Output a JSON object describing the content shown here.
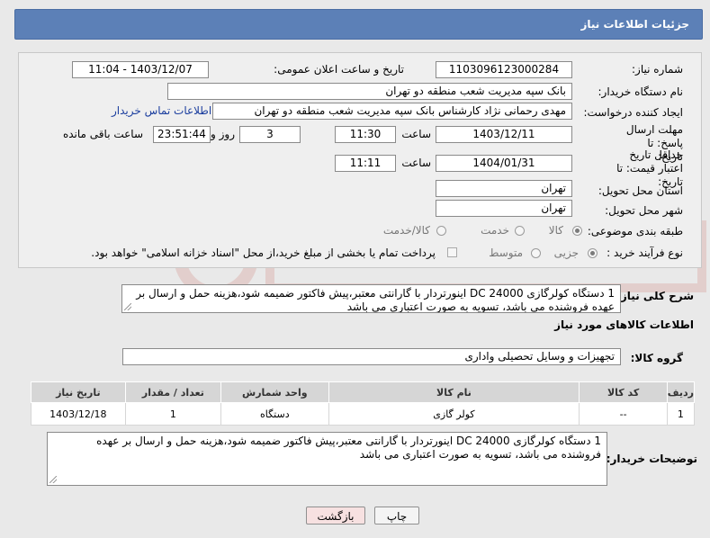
{
  "header": {
    "title": "جزئیات اطلاعات نیاز"
  },
  "form": {
    "need_number_label": "شماره نیاز:",
    "need_number": "1103096123000284",
    "announce_label": "تاریخ و ساعت اعلان عمومی:",
    "announce_value": "1403/12/07 - 11:04",
    "buyer_label": "نام دستگاه خریدار:",
    "buyer_value": "بانک سپه مدیریت شعب منطقه دو تهران",
    "creator_label": "ایجاد کننده درخواست:",
    "creator_value": "مهدی رحمانی نژاد کارشناس بانک سپه مدیریت شعب منطقه دو تهران",
    "contact_link": "اطلاعات تماس خریدار",
    "deadline_label": "مهلت ارسال پاسخ: تا تاریخ:",
    "deadline_date": "1403/12/11",
    "time_label": "ساعت",
    "deadline_time": "11:30",
    "days_value": "3",
    "days_label": "روز و",
    "remaining_time": "23:51:44",
    "remaining_label": "ساعت باقی مانده",
    "price_label": "حداقل تاریخ اعتبار قیمت: تا تاریخ:",
    "price_date": "1404/01/31",
    "price_time": "11:11",
    "province_label": "استان محل تحویل:",
    "province_value": "تهران",
    "city_label": "شهر محل تحویل:",
    "city_value": "تهران",
    "category_label": "طبقه بندی موضوعی:",
    "category_options": [
      "کالا",
      "خدمت",
      "کالا/خدمت"
    ],
    "process_label": "نوع فرآیند خرید :",
    "process_options": [
      "جزیی",
      "متوسط"
    ],
    "payment_text": "پرداخت تمام یا بخشی از مبلغ خرید،از محل \"اسناد خزانه اسلامی\" خواهد بود."
  },
  "summary": {
    "label": "شرح کلی نیاز:",
    "text": "1 دستگاه کولرگازی DC 24000 اینورتردار با گارانتی معتبر،پیش فاکتور  ضمیمه شود،هزینه حمل و ارسال بر عهده فروشنده می باشد، تسویه به صورت اعتباری می باشد"
  },
  "goods_info": {
    "title": "اطلاعات کالاهای مورد نیاز",
    "group_label": "گروه کالا:",
    "group_value": "تجهیزات و وسایل تحصیلی واداری"
  },
  "table": {
    "headers": [
      "ردیف",
      "کد کالا",
      "نام کالا",
      "واحد شمارش",
      "تعداد / مقدار",
      "تاریخ نیاز"
    ],
    "rows": [
      [
        "1",
        "--",
        "کولر گازی",
        "دستگاه",
        "1",
        "1403/12/18"
      ]
    ]
  },
  "buyer_notes": {
    "label": "توضیحات خریدار:",
    "text": "1 دستگاه کولرگازی DC 24000 اینورتردار با گارانتی معتبر،پیش فاکتور  ضمیمه شود،هزینه حمل و ارسال بر عهده فروشنده می باشد، تسویه به صورت اعتباری می باشد"
  },
  "buttons": {
    "print": "چاپ",
    "back": "بازگشت"
  },
  "colors": {
    "header_bg": "#5c80b7",
    "link": "#1a3d9e",
    "back_bg": "#f7e1e1"
  }
}
